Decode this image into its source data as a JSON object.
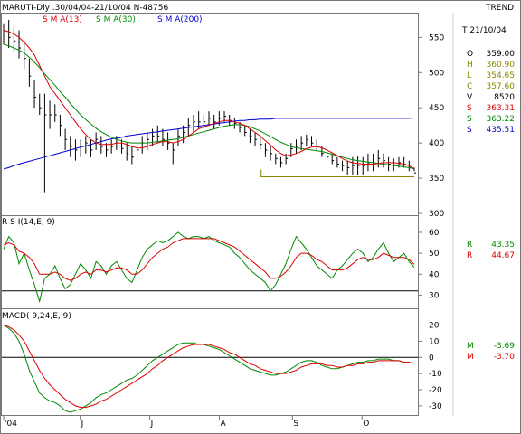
{
  "header": {
    "title": "MARUTI-Dly .30/04/04-21/10/04  N-48756",
    "trend_label": "TREND",
    "sma_labels": [
      {
        "text": "S M A(13)",
        "color": "#dd0000"
      },
      {
        "text": "S M A(30)",
        "color": "#008800"
      },
      {
        "text": "S M A(200)",
        "color": "#0000cc"
      }
    ]
  },
  "readout": {
    "date": "T 21/10/04",
    "rows": [
      {
        "label": "O",
        "value": "359.00",
        "color": "#000000"
      },
      {
        "label": "H",
        "value": "360.90",
        "color": "#888800"
      },
      {
        "label": "L",
        "value": "354.65",
        "color": "#888800"
      },
      {
        "label": "C",
        "value": "357.60",
        "color": "#888800"
      },
      {
        "label": "V",
        "value": "8520",
        "color": "#000000"
      },
      {
        "label": "S",
        "value": "363.31",
        "color": "#dd0000"
      },
      {
        "label": "S",
        "value": "363.22",
        "color": "#008800"
      },
      {
        "label": "S",
        "value": "435.51",
        "color": "#0000cc"
      }
    ]
  },
  "rsi_panel": {
    "label": "R S I(14,E, 9)",
    "readout": [
      {
        "label": "R",
        "value": "43.35",
        "color": "#008800"
      },
      {
        "label": "R",
        "value": "44.67",
        "color": "#dd0000"
      }
    ]
  },
  "macd_panel": {
    "label": "MACD( 9,24,E, 9)",
    "readout": [
      {
        "label": "M",
        "value": "-3.69",
        "color": "#008800"
      },
      {
        "label": "M",
        "value": "-3.70",
        "color": "#dd0000"
      }
    ]
  },
  "x_axis": {
    "labels": [
      "'04",
      "J",
      "J",
      "A",
      "S",
      "O"
    ]
  },
  "chart_data": [
    {
      "type": "line",
      "panel": "price",
      "title": "MARUTI-Dly .30/04/04-21/10/04  N-48756",
      "ylim": [
        300,
        580
      ],
      "yticks": [
        300,
        350,
        400,
        450,
        500,
        550
      ],
      "x_range": [
        0,
        118
      ],
      "x_ticks": [
        {
          "label": "'04",
          "x": 0
        },
        {
          "label": "J",
          "x": 22
        },
        {
          "label": "J",
          "x": 42
        },
        {
          "label": "A",
          "x": 62
        },
        {
          "label": "S",
          "x": 83
        },
        {
          "label": "O",
          "x": 103
        }
      ],
      "price_bars": {
        "low": [
          540,
          535,
          530,
          520,
          505,
          480,
          450,
          440,
          330,
          420,
          430,
          410,
          390,
          380,
          375,
          380,
          385,
          380,
          390,
          385,
          380,
          385,
          390,
          385,
          375,
          370,
          375,
          385,
          390,
          395,
          400,
          395,
          390,
          370,
          395,
          400,
          410,
          415,
          420,
          420,
          425,
          420,
          425,
          430,
          425,
          420,
          415,
          410,
          400,
          395,
          390,
          380,
          375,
          370,
          365,
          370,
          380,
          385,
          390,
          395,
          395,
          390,
          380,
          375,
          370,
          365,
          360,
          355,
          355,
          355,
          355,
          360,
          360,
          365,
          365,
          360,
          360,
          365,
          365,
          360,
          360
        ],
        "high": [
          570,
          575,
          565,
          560,
          545,
          520,
          490,
          470,
          470,
          460,
          455,
          440,
          420,
          410,
          405,
          405,
          410,
          405,
          415,
          410,
          400,
          405,
          410,
          405,
          400,
          395,
          400,
          410,
          415,
          420,
          425,
          420,
          415,
          400,
          420,
          425,
          435,
          440,
          445,
          440,
          445,
          440,
          445,
          445,
          440,
          435,
          430,
          425,
          420,
          415,
          410,
          400,
          395,
          385,
          380,
          385,
          400,
          405,
          410,
          412,
          410,
          405,
          395,
          390,
          385,
          380,
          375,
          375,
          380,
          382,
          380,
          385,
          385,
          390,
          385,
          380,
          378,
          380,
          380,
          375,
          365
        ],
        "close": [
          560,
          550,
          545,
          535,
          520,
          495,
          465,
          450,
          440,
          440,
          440,
          425,
          405,
          395,
          390,
          395,
          400,
          390,
          405,
          395,
          390,
          395,
          400,
          392,
          385,
          380,
          390,
          400,
          405,
          410,
          410,
          405,
          400,
          390,
          410,
          415,
          425,
          430,
          430,
          430,
          435,
          430,
          435,
          438,
          432,
          428,
          422,
          415,
          410,
          405,
          398,
          390,
          385,
          378,
          372,
          378,
          392,
          395,
          400,
          405,
          400,
          395,
          385,
          380,
          375,
          370,
          368,
          365,
          368,
          368,
          368,
          372,
          372,
          378,
          375,
          370,
          368,
          372,
          370,
          365,
          357.6
        ]
      },
      "series": [
        {
          "name": "S M A(13)",
          "color": "#dd0000",
          "values": [
            560,
            558,
            555,
            550,
            543,
            535,
            525,
            510,
            495,
            480,
            470,
            460,
            450,
            440,
            430,
            420,
            412,
            405,
            400,
            398,
            398,
            398,
            400,
            400,
            398,
            395,
            393,
            393,
            395,
            398,
            400,
            402,
            402,
            400,
            402,
            405,
            410,
            415,
            420,
            423,
            425,
            428,
            430,
            432,
            432,
            430,
            428,
            425,
            420,
            415,
            410,
            403,
            397,
            390,
            385,
            382,
            383,
            385,
            388,
            392,
            394,
            395,
            393,
            390,
            386,
            382,
            378,
            374,
            372,
            371,
            370,
            370,
            370,
            371,
            372,
            372,
            372,
            371,
            370,
            368,
            363.31
          ]
        },
        {
          "name": "S M A(30)",
          "color": "#008800",
          "values": [
            540,
            538,
            535,
            532,
            528,
            522,
            515,
            507,
            498,
            490,
            482,
            473,
            465,
            456,
            448,
            440,
            433,
            427,
            421,
            416,
            412,
            408,
            405,
            403,
            401,
            400,
            400,
            400,
            400,
            401,
            402,
            403,
            404,
            405,
            406,
            408,
            410,
            412,
            414,
            416,
            418,
            420,
            422,
            424,
            425,
            426,
            426,
            425,
            423,
            420,
            417,
            413,
            409,
            405,
            401,
            398,
            395,
            393,
            392,
            391,
            390,
            389,
            388,
            386,
            384,
            382,
            380,
            378,
            376,
            375,
            374,
            373,
            372,
            371,
            370,
            369,
            368,
            367,
            366,
            365,
            363.22
          ]
        },
        {
          "name": "S M A(200)",
          "color": "#0000cc",
          "values": [
            363,
            365,
            368,
            370,
            372,
            374,
            376,
            378,
            380,
            382,
            384,
            386,
            388,
            390,
            392,
            394,
            396,
            398,
            400,
            402,
            404,
            406,
            407,
            408,
            410,
            411,
            412,
            413,
            414,
            415,
            416,
            417,
            418,
            419,
            420,
            421,
            422,
            423,
            424,
            425,
            426,
            427,
            428,
            429,
            430,
            431,
            432,
            432,
            433,
            433,
            434,
            434,
            434,
            435,
            435,
            435,
            435,
            435,
            435,
            435,
            435,
            435,
            435,
            435,
            435,
            435,
            435,
            435,
            435,
            435,
            435,
            435,
            435,
            435,
            435,
            435,
            435,
            435,
            435,
            435,
            435.51
          ]
        }
      ],
      "support_line": {
        "value": 352,
        "x_from": 74,
        "x_to": 80
      }
    },
    {
      "type": "line",
      "panel": "rsi",
      "title": "R S I(14,E, 9)",
      "ylim": [
        25,
        63
      ],
      "yticks": [
        30,
        40,
        50,
        60
      ],
      "reference_line": 32,
      "series": [
        {
          "name": "R",
          "color": "#008800",
          "values": [
            52,
            58,
            55,
            45,
            50,
            42,
            35,
            27,
            38,
            40,
            44,
            38,
            33,
            35,
            40,
            45,
            42,
            38,
            46,
            44,
            40,
            44,
            46,
            42,
            38,
            36,
            42,
            48,
            52,
            54,
            56,
            55,
            56,
            58,
            60,
            58,
            57,
            58,
            58,
            57,
            58,
            56,
            55,
            54,
            53,
            50,
            48,
            45,
            42,
            40,
            38,
            36,
            32,
            35,
            40,
            45,
            52,
            58,
            55,
            52,
            48,
            44,
            42,
            40,
            38,
            42,
            44,
            47,
            50,
            52,
            50,
            46,
            48,
            52,
            55,
            50,
            46,
            48,
            50,
            46,
            43.35
          ]
        },
        {
          "name": "R",
          "color": "#dd0000",
          "values": [
            54,
            55,
            54,
            51,
            50,
            48,
            45,
            40,
            40,
            40,
            41,
            40,
            38,
            37,
            38,
            40,
            41,
            40,
            42,
            42,
            41,
            42,
            43,
            43,
            42,
            40,
            40,
            42,
            45,
            48,
            50,
            52,
            53,
            55,
            56,
            57,
            57,
            57,
            57,
            57,
            57,
            57,
            56,
            55,
            54,
            53,
            51,
            49,
            47,
            45,
            43,
            41,
            38,
            38,
            39,
            41,
            44,
            48,
            50,
            50,
            49,
            47,
            46,
            44,
            42,
            42,
            42,
            43,
            45,
            47,
            48,
            47,
            47,
            48,
            50,
            49,
            48,
            48,
            48,
            47,
            44.67
          ]
        }
      ]
    },
    {
      "type": "line",
      "panel": "macd",
      "title": "MACD( 9,24,E, 9)",
      "ylim": [
        -34,
        22
      ],
      "yticks": [
        -30,
        -20,
        -10,
        0,
        10,
        20
      ],
      "reference_line": 0,
      "series": [
        {
          "name": "M",
          "color": "#008800",
          "values": [
            20,
            18,
            15,
            10,
            2,
            -8,
            -15,
            -22,
            -25,
            -27,
            -28,
            -30,
            -33,
            -34,
            -33,
            -32,
            -30,
            -28,
            -25,
            -23,
            -22,
            -20,
            -18,
            -16,
            -14,
            -13,
            -11,
            -8,
            -5,
            -2,
            0,
            2,
            4,
            6,
            8,
            9,
            9,
            9,
            8,
            8,
            7,
            6,
            5,
            3,
            1,
            -1,
            -3,
            -5,
            -7,
            -8,
            -9,
            -10,
            -11,
            -11,
            -10,
            -9,
            -7,
            -5,
            -3,
            -2,
            -2,
            -3,
            -5,
            -6,
            -7,
            -7,
            -6,
            -5,
            -4,
            -3,
            -3,
            -2,
            -2,
            -1,
            -1,
            -1,
            -2,
            -2,
            -3,
            -3,
            -3.69
          ]
        },
        {
          "name": "M",
          "color": "#dd0000",
          "values": [
            20,
            19,
            17,
            14,
            10,
            4,
            -2,
            -8,
            -13,
            -17,
            -20,
            -23,
            -26,
            -28,
            -30,
            -31,
            -31,
            -30,
            -29,
            -27,
            -26,
            -24,
            -22,
            -20,
            -18,
            -16,
            -14,
            -12,
            -10,
            -7,
            -5,
            -2,
            0,
            2,
            4,
            6,
            7,
            8,
            8,
            8,
            8,
            7,
            6,
            5,
            3,
            2,
            0,
            -2,
            -4,
            -5,
            -7,
            -8,
            -9,
            -10,
            -10,
            -10,
            -9,
            -8,
            -6,
            -5,
            -4,
            -4,
            -4,
            -5,
            -5,
            -6,
            -6,
            -5,
            -5,
            -4,
            -4,
            -3,
            -3,
            -2,
            -2,
            -2,
            -2,
            -2,
            -3,
            -3,
            -3.7
          ]
        }
      ]
    }
  ]
}
